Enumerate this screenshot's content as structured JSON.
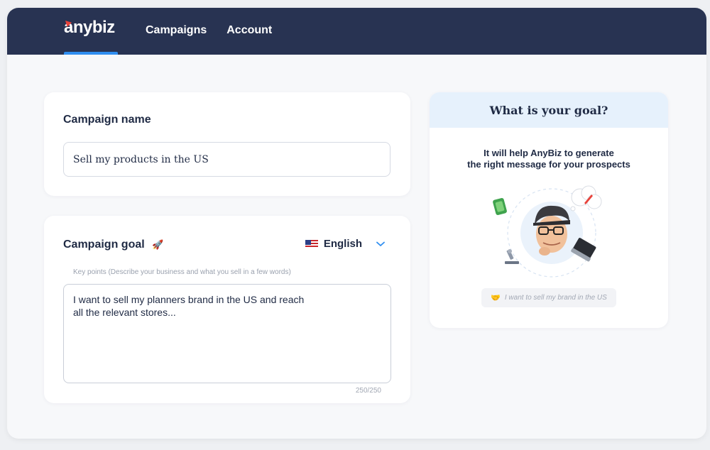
{
  "app": {
    "logo_text": "anybiz"
  },
  "nav": {
    "items": [
      "Campaigns",
      "Account"
    ]
  },
  "campaign_name": {
    "title": "Campaign name",
    "value": "Sell my products in the US"
  },
  "campaign_goal": {
    "title": "Campaign goal",
    "title_icon": "rocket-icon",
    "language": "English",
    "hint": "Key points (Describe your business and what you sell in a few words)",
    "value": "I want to sell my planners brand in the US and reach\nall the relevant stores...",
    "counter": "250/250"
  },
  "goal_panel": {
    "title": "What is your goal?",
    "description": "It will help AnyBiz to generate\nthe right message for your prospects",
    "example": "I want to sell my brand in the US",
    "example_icon": "handshake-icon"
  },
  "colors": {
    "topbar": "#283352",
    "accent": "#2f8ef0",
    "logo_mark": "#e8423a",
    "goal_header_bg": "#e6f1fc"
  }
}
